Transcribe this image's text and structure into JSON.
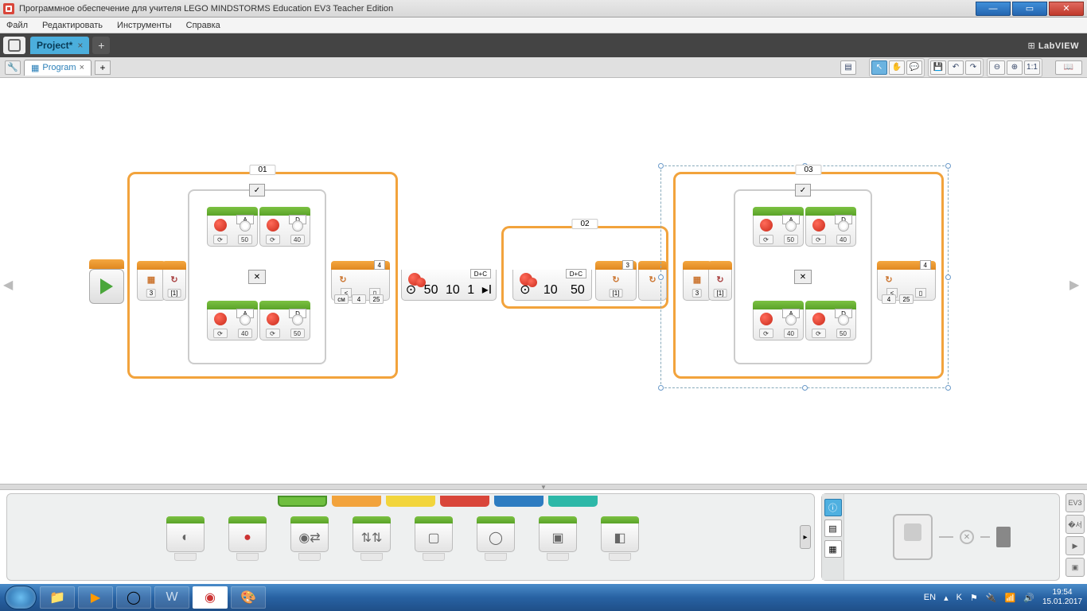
{
  "window": {
    "title": "Программное обеспечение для учителя LEGO MINDSTORMS Education EV3 Teacher Edition"
  },
  "menu": {
    "file": "Файл",
    "edit": "Редактировать",
    "tools": "Инструменты",
    "help": "Справка"
  },
  "project_tab": {
    "name": "Project*",
    "close": "×",
    "add": "+"
  },
  "brand": {
    "text": "LabVIEW"
  },
  "program_tab": {
    "name": "Program",
    "close": "×",
    "add": "+"
  },
  "toolbar": {
    "pointer": "↖",
    "pan": "✋",
    "comment": "💬",
    "save": "💾",
    "undo": "↶",
    "redo": "↷",
    "zoom_out": "⊖",
    "zoom_in": "⊕",
    "zoom_fit": "1:1",
    "doc": "▤",
    "book": "📖"
  },
  "loops": {
    "l1": "01",
    "l2": "02",
    "l3": "03"
  },
  "switch": {
    "check": "✓",
    "x": "✕"
  },
  "blocks": {
    "start": "▶",
    "portA": "A",
    "portD": "D",
    "portDC": "D+C",
    "v50": "50",
    "v40": "40",
    "v25": "25",
    "v10": "10",
    "v1": "1",
    "v3": "3",
    "v4": "4",
    "n1": "[1]",
    "lt": "<",
    "cm": "см"
  },
  "palette": {
    "items": [
      "med-motor",
      "lrg-motor",
      "move-steer",
      "move-tank",
      "display",
      "sound",
      "brick-light",
      "screen"
    ]
  },
  "hw": {
    "ev3": "EV3",
    "x": "✕"
  },
  "systray": {
    "lang": "EN",
    "time": "19:54",
    "date": "15.01.2017"
  }
}
